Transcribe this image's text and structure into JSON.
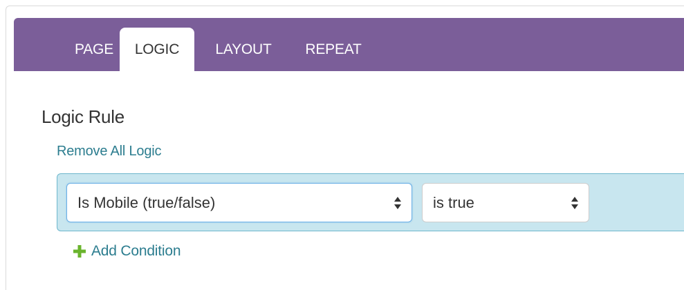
{
  "tabs": [
    {
      "label": "PAGE",
      "active": false
    },
    {
      "label": "LOGIC",
      "active": true
    },
    {
      "label": "LAYOUT",
      "active": false
    },
    {
      "label": "REPEAT",
      "active": false
    }
  ],
  "logic": {
    "heading": "Logic Rule",
    "remove_label": "Remove All Logic",
    "condition": {
      "field_value": "Is Mobile (true/false)",
      "operator_value": "is true"
    },
    "add_condition_label": "Add Condition"
  },
  "colors": {
    "tab_bar": "#7b5e99",
    "link": "#2c7d8f",
    "rule_background": "#c8e6ef",
    "plus_icon": "#6ab42d"
  },
  "icons": {
    "select_arrows": "sort-arrows-icon",
    "add": "plus-icon"
  }
}
